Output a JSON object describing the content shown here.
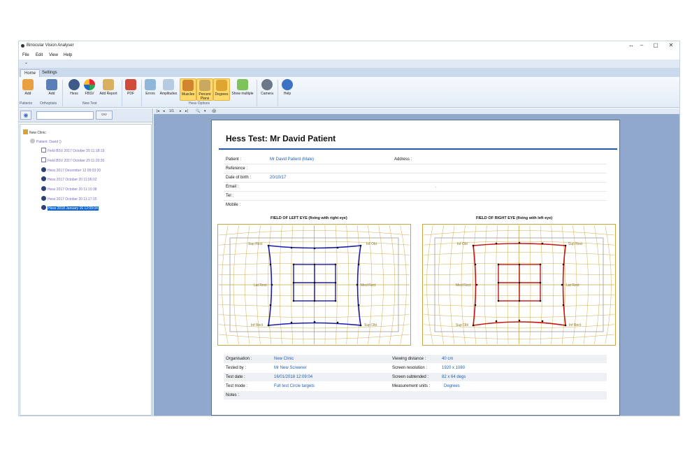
{
  "window": {
    "title": "Binocular Vision Analyser",
    "controls": [
      "↔",
      "–",
      "▢",
      "✕"
    ]
  },
  "menu": [
    "File",
    "Edit",
    "View",
    "Help"
  ],
  "qat": {
    "glyph": "⌄"
  },
  "ribbon": {
    "tabs": [
      "Home",
      "Settings"
    ],
    "buttons": [
      "Add",
      "Add",
      "Hess",
      "FBSV",
      "Add Report",
      "PDF",
      "Errors",
      "Amplitudes",
      "Muscles",
      "Percent Plans",
      "Degrees",
      "Show multiple",
      "Camera",
      "Help"
    ],
    "groups": [
      "Patients",
      "Orthoptists",
      "New Test",
      "Hess Options"
    ]
  },
  "sidebar": {
    "eye_button": "◉",
    "search_placeholder": "",
    "search_button": "👓",
    "tree": [
      {
        "label": "New Clinic"
      },
      {
        "label": "Patient: David ()"
      },
      {
        "label": "Field BSV 2017 October 20 11:18:19"
      },
      {
        "label": "Field BSV 2017 October 20 11:20:30"
      },
      {
        "label": "Hess 2017 December 12 09:03:20"
      },
      {
        "label": "Hess 2017 October 20 11:06:02"
      },
      {
        "label": "Hess 2017 October 20 11:10:38"
      },
      {
        "label": "Hess 2017 October 20 11:17:15"
      },
      {
        "label": "Hess 2018 January 16 12:09:04"
      }
    ]
  },
  "viewer_toolbar": {
    "page": "1/1",
    "nav_first": "|◂",
    "nav_prev": "◂",
    "nav_next": "▸",
    "nav_last": "▸|",
    "zoom": "🔍",
    "zoom_menu": "▾",
    "print": "🖨"
  },
  "report": {
    "title": "Hess Test:   Mr David Patient",
    "patient_rows": [
      {
        "key": "Patient :",
        "value": "Mr David Patient (Male)"
      },
      {
        "key": "Reference :",
        "value": ""
      },
      {
        "key": "Date of birth :",
        "value": "20/10/17"
      },
      {
        "key": "Email :",
        "value": ""
      },
      {
        "key": "Tel :",
        "value": ""
      },
      {
        "key": "Mobile :",
        "value": ""
      }
    ],
    "address_label": "Address :",
    "address_value": ".",
    "left_chart_title": "FIELD OF LEFT EYE (fixing with right eye)",
    "right_chart_title": "FIELD OF RIGHT EYE (fixing with left eye)",
    "left_labels": [
      "Inf Obl",
      "Sup Obl",
      "Lat Rect",
      "Med Rect",
      "Inf Rect",
      "Sup Obl"
    ],
    "left_labels_top": [
      "Sup Rect",
      "Inf Obl"
    ],
    "right_labels_top": [
      "Inf Obl",
      "Sup Rect"
    ],
    "right_labels_mid": [
      "Med Rect",
      "Lat Rect"
    ],
    "right_labels_bot": [
      "Sup Obl",
      "Inf Rect"
    ],
    "footer_left": [
      {
        "key": "Organisation :",
        "value": "New Clinic"
      },
      {
        "key": "Tested by :",
        "value": "Mr New Screener"
      },
      {
        "key": "Test date :",
        "value": "16/01/2018 12:09:04"
      },
      {
        "key": "Test mode :",
        "value": "Full test   Circle targets"
      },
      {
        "key": "Notes :",
        "value": ""
      }
    ],
    "footer_right": [
      {
        "key": "Viewing distance :",
        "value": "40 cm"
      },
      {
        "key": "Screen resolution :",
        "value": "1920 x 1080"
      },
      {
        "key": "Screen subtended :",
        "value": "82 x 64 degs"
      },
      {
        "key": "Measurement units :",
        "value": "Degrees"
      }
    ],
    "colors": {
      "left_plot": "#1b1bb0",
      "right_plot": "#c81414",
      "grid": "#c9a640",
      "rule": "#1e5aa8"
    }
  }
}
